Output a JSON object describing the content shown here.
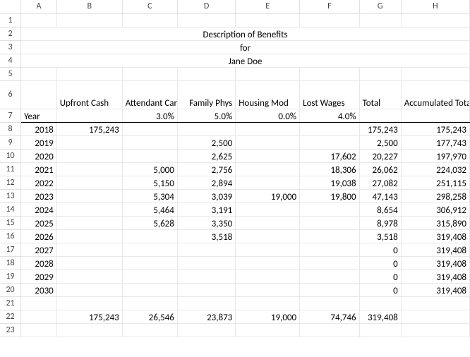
{
  "columns": [
    "A",
    "B",
    "C",
    "D",
    "E",
    "F",
    "G",
    "H"
  ],
  "row_numbers": [
    "1",
    "2",
    "3",
    "4",
    "5",
    "6",
    "7",
    "8",
    "9",
    "10",
    "11",
    "12",
    "13",
    "14",
    "15",
    "16",
    "17",
    "18",
    "19",
    "20",
    "21",
    "22",
    "23"
  ],
  "title1": "Description of Benefits",
  "title2": "for",
  "title3": "Jane Doe",
  "headers": {
    "year": "Year",
    "upfront": "Upfront Cash",
    "attendant": "Attendant Care",
    "family": "Family Phys",
    "housing": "Housing Mod",
    "lost": "Lost Wages",
    "total": "Total",
    "acc": "Accumulated Total"
  },
  "rates": {
    "attendant": "3.0%",
    "family": "5.0%",
    "housing": "0.0%",
    "lost": "4.0%"
  },
  "rows": [
    {
      "year": "2018",
      "upfront": "175,243",
      "attendant": "",
      "family": "",
      "housing": "",
      "lost": "",
      "total": "175,243",
      "acc": "175,243"
    },
    {
      "year": "2019",
      "upfront": "",
      "attendant": "",
      "family": "2,500",
      "housing": "",
      "lost": "",
      "total": "2,500",
      "acc": "177,743"
    },
    {
      "year": "2020",
      "upfront": "",
      "attendant": "",
      "family": "2,625",
      "housing": "",
      "lost": "17,602",
      "total": "20,227",
      "acc": "197,970"
    },
    {
      "year": "2021",
      "upfront": "",
      "attendant": "5,000",
      "family": "2,756",
      "housing": "",
      "lost": "18,306",
      "total": "26,062",
      "acc": "224,032"
    },
    {
      "year": "2022",
      "upfront": "",
      "attendant": "5,150",
      "family": "2,894",
      "housing": "",
      "lost": "19,038",
      "total": "27,082",
      "acc": "251,115"
    },
    {
      "year": "2023",
      "upfront": "",
      "attendant": "5,304",
      "family": "3,039",
      "housing": "19,000",
      "lost": "19,800",
      "total": "47,143",
      "acc": "298,258"
    },
    {
      "year": "2024",
      "upfront": "",
      "attendant": "5,464",
      "family": "3,191",
      "housing": "",
      "lost": "",
      "total": "8,654",
      "acc": "306,912"
    },
    {
      "year": "2025",
      "upfront": "",
      "attendant": "5,628",
      "family": "3,350",
      "housing": "",
      "lost": "",
      "total": "8,978",
      "acc": "315,890"
    },
    {
      "year": "2026",
      "upfront": "",
      "attendant": "",
      "family": "3,518",
      "housing": "",
      "lost": "",
      "total": "3,518",
      "acc": "319,408"
    },
    {
      "year": "2027",
      "upfront": "",
      "attendant": "",
      "family": "",
      "housing": "",
      "lost": "",
      "total": "0",
      "acc": "319,408"
    },
    {
      "year": "2028",
      "upfront": "",
      "attendant": "",
      "family": "",
      "housing": "",
      "lost": "",
      "total": "0",
      "acc": "319,408"
    },
    {
      "year": "2029",
      "upfront": "",
      "attendant": "",
      "family": "",
      "housing": "",
      "lost": "",
      "total": "0",
      "acc": "319,408"
    },
    {
      "year": "2030",
      "upfront": "",
      "attendant": "",
      "family": "",
      "housing": "",
      "lost": "",
      "total": "0",
      "acc": "319,408"
    }
  ],
  "totals": {
    "upfront": "175,243",
    "attendant": "26,546",
    "family": "23,873",
    "housing": "19,000",
    "lost": "74,746",
    "total": "319,408"
  }
}
